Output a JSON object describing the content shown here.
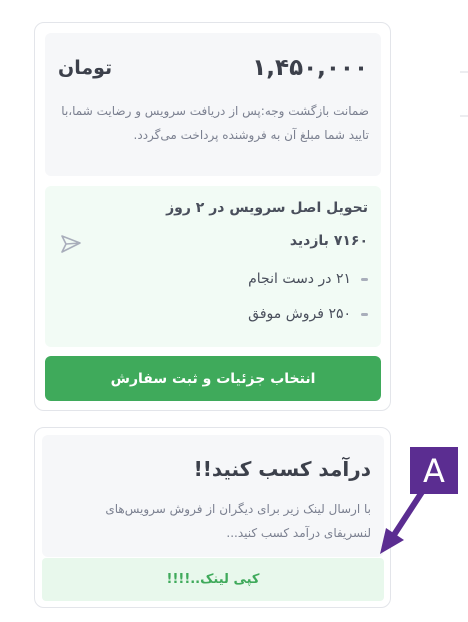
{
  "service_card": {
    "price": "۱,۴۵۰,۰۰۰",
    "currency": "تومان",
    "guarantee_text": "ضمانت بازگشت وجه:پس از دریافت سرویس و رضایت شما،با تایید شما مبلغ آن به فروشنده پرداخت می‌گردد.",
    "delivery": "تحویل اصل سرویس در ۲ روز",
    "views": "۷۱۶۰ بازدید",
    "in_progress": "۲۱ در دست انجام",
    "successful_sales": "۲۵۰ فروش موفق",
    "order_button": "انتخاب جزئیات و ثبت سفارش",
    "send_icon": "send-icon"
  },
  "earn_card": {
    "title": "درآمد کسب کنید!!",
    "description": "با ارسال لینک زیر برای دیگران از فروش سرویس‌های لنسریفای درآمد کسب کنید...",
    "copy_button": "کپی لینک..!!!!"
  },
  "annotation": {
    "label": "A",
    "color": "#5b2d91"
  },
  "colors": {
    "accent_green": "#3faa5b",
    "light_green_bg": "#f2fbf5",
    "panel_bg": "#f6f7f9"
  }
}
